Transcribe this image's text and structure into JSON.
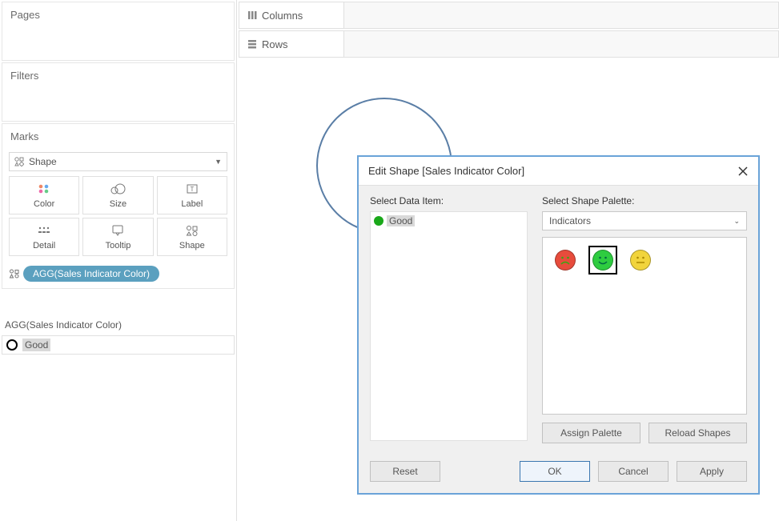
{
  "sidebar": {
    "pages_title": "Pages",
    "filters_title": "Filters",
    "marks_title": "Marks",
    "marks_type": "Shape",
    "mark_btns": {
      "color": "Color",
      "size": "Size",
      "label": "Label",
      "detail": "Detail",
      "tooltip": "Tooltip",
      "shape": "Shape"
    },
    "pill_label": "AGG(Sales Indicator Color)"
  },
  "legend": {
    "title": "AGG(Sales Indicator Color)",
    "item": "Good"
  },
  "shelves": {
    "columns": "Columns",
    "rows": "Rows"
  },
  "dialog": {
    "title": "Edit Shape [Sales Indicator Color]",
    "select_item_label": "Select Data Item:",
    "data_item": "Good",
    "select_palette_label": "Select Shape Palette:",
    "palette_name": "Indicators",
    "assign_btn": "Assign Palette",
    "reload_btn": "Reload Shapes",
    "reset_btn": "Reset",
    "ok_btn": "OK",
    "cancel_btn": "Cancel",
    "apply_btn": "Apply"
  }
}
